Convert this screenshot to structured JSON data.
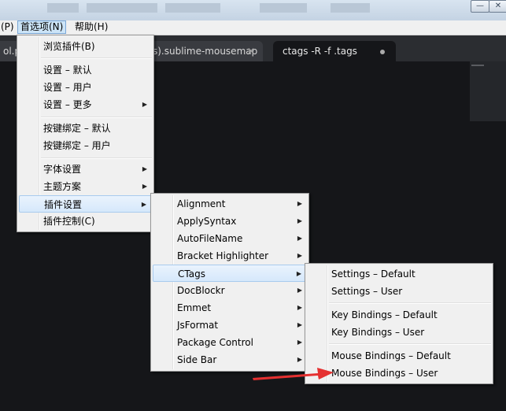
{
  "window": {
    "minimize_glyph": "—",
    "close_glyph": "✕"
  },
  "menubar": {
    "items": [
      "(P)",
      "首选项(N)",
      "帮助(H)"
    ]
  },
  "tabs": [
    {
      "label": "ol.p",
      "close": ""
    },
    {
      "label": "s).sublime-mousemap",
      "close": "✕"
    },
    {
      "label": "ctags -R -f .tags",
      "close": ""
    }
  ],
  "preferences_menu": {
    "items": [
      {
        "label": "浏览插件(B)",
        "submenu": false
      },
      {
        "label": "设置 – 默认",
        "submenu": false
      },
      {
        "label": "设置 – 用户",
        "submenu": false
      },
      {
        "label": "设置 – 更多",
        "submenu": true
      },
      {
        "label": "按键绑定 – 默认",
        "submenu": false
      },
      {
        "label": "按键绑定 – 用户",
        "submenu": false
      },
      {
        "label": "字体设置",
        "submenu": true
      },
      {
        "label": "主题方案",
        "submenu": true
      },
      {
        "label": "插件设置",
        "submenu": true,
        "highlighted": true
      },
      {
        "label": "插件控制(C)",
        "submenu": false
      }
    ]
  },
  "plugin_menu": {
    "items": [
      {
        "label": "Alignment",
        "submenu": true
      },
      {
        "label": "ApplySyntax",
        "submenu": true
      },
      {
        "label": "AutoFileName",
        "submenu": true
      },
      {
        "label": "Bracket Highlighter",
        "submenu": true
      },
      {
        "label": "CTags",
        "submenu": true,
        "highlighted": true
      },
      {
        "label": "DocBlockr",
        "submenu": true
      },
      {
        "label": "Emmet",
        "submenu": true
      },
      {
        "label": "JsFormat",
        "submenu": true
      },
      {
        "label": "Package Control",
        "submenu": true
      },
      {
        "label": "Side Bar",
        "submenu": true
      }
    ]
  },
  "ctags_menu": {
    "items": [
      {
        "label": "Settings – Default"
      },
      {
        "label": "Settings – User"
      },
      {
        "label": "Key Bindings – Default"
      },
      {
        "label": "Key Bindings – User"
      },
      {
        "label": "Mouse Bindings – Default"
      },
      {
        "label": "Mouse Bindings – User"
      }
    ]
  },
  "icons": {
    "submenu_arrow": "▶"
  },
  "colors": {
    "editor_bg": "#151619",
    "annotation_arrow": "#e53030",
    "menu_highlight": "#d6e8fb"
  }
}
